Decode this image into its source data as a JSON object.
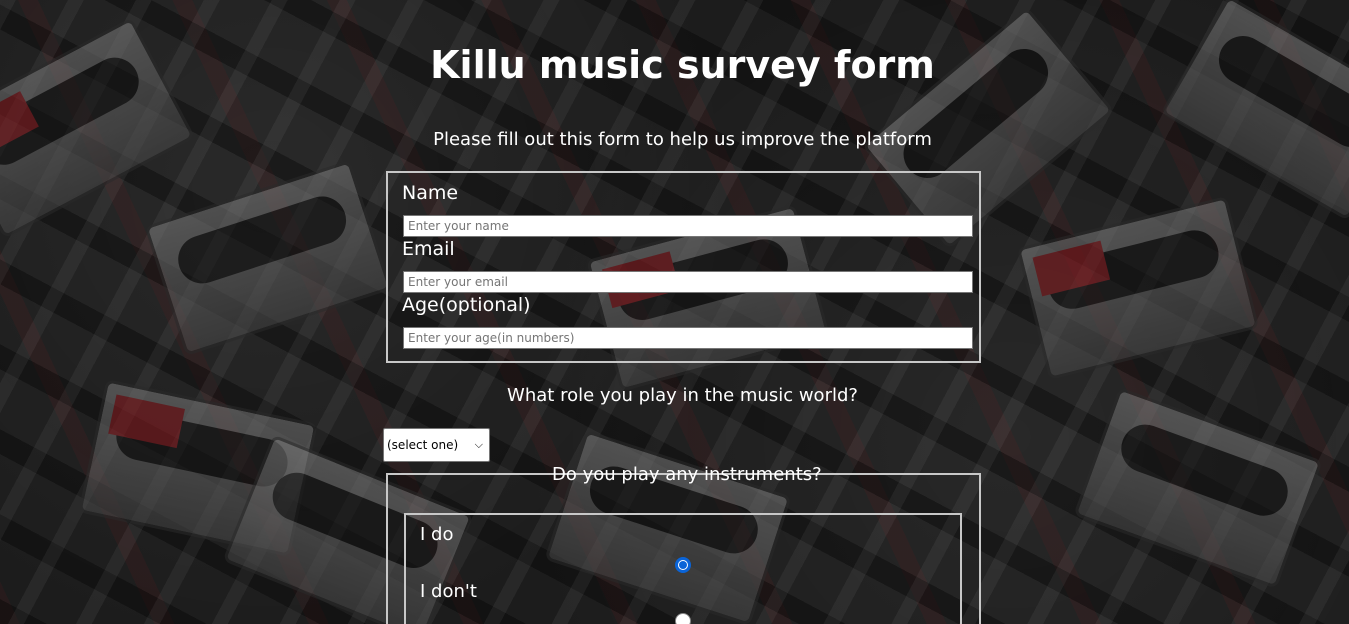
{
  "header": {
    "title": "Killu music survey form",
    "subtitle": "Please fill out this form to help us improve the platform"
  },
  "fields": [
    {
      "label": "Name",
      "placeholder": "Enter your name"
    },
    {
      "label": "Email",
      "placeholder": "Enter your email"
    },
    {
      "label": "Age(optional)",
      "placeholder": "Enter your age(in numbers)"
    }
  ],
  "role": {
    "question": "What role you play in the music world?",
    "selected": "(select one)"
  },
  "instruments": {
    "legend": "Do you play any instruments?",
    "options": [
      {
        "label": "I do",
        "checked": true
      },
      {
        "label": "I don't",
        "checked": false
      }
    ]
  },
  "icons": {
    "select": "chevron-down-icon"
  },
  "colors": {
    "radio_accent": "#0a64d8",
    "border": "#c8c8c8",
    "text": "#ffffff"
  }
}
